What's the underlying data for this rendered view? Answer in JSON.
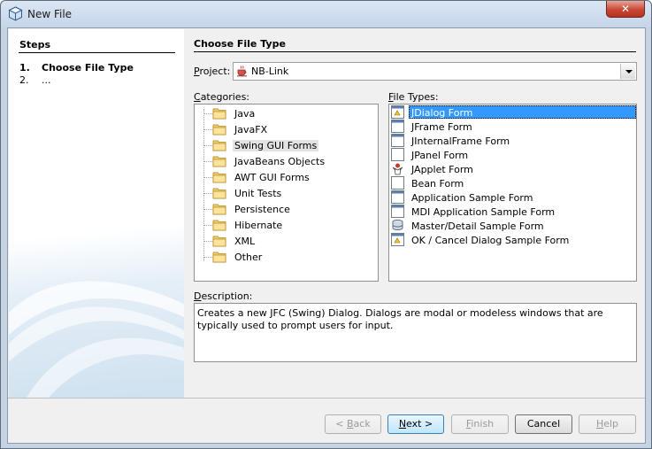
{
  "window": {
    "title": "New File",
    "close_glyph": "✕"
  },
  "steps": {
    "title": "Steps",
    "items": [
      {
        "num": "1.",
        "label": "Choose File Type"
      },
      {
        "num": "2.",
        "label": "..."
      }
    ]
  },
  "main": {
    "title": "Choose File Type",
    "project": {
      "label_u": "P",
      "label_rest": "roject:",
      "value": "NB-Link"
    },
    "categories": {
      "label_u": "C",
      "label_rest": "ategories:",
      "items": [
        "Java",
        "JavaFX",
        "Swing GUI Forms",
        "JavaBeans Objects",
        "AWT GUI Forms",
        "Unit Tests",
        "Persistence",
        "Hibernate",
        "XML",
        "Other"
      ],
      "selected": "Swing GUI Forms"
    },
    "file_types": {
      "label_u": "F",
      "label_rest": "ile Types:",
      "items": [
        "JDialog Form",
        "JFrame Form",
        "JInternalFrame Form",
        "JPanel Form",
        "JApplet Form",
        "Bean Form",
        "Application Sample Form",
        "MDI Application Sample Form",
        "Master/Detail Sample Form",
        "OK / Cancel Dialog Sample Form"
      ],
      "selected": "JDialog Form"
    },
    "description": {
      "label_u": "D",
      "label_rest": "escription:",
      "text": "Creates a new JFC (Swing) Dialog. Dialogs are modal or modeless windows that are typically used to prompt users for input."
    }
  },
  "buttons": {
    "back": {
      "prefix": "< ",
      "u": "B",
      "rest": "ack"
    },
    "next": {
      "prefix": "",
      "u": "N",
      "rest": "ext >"
    },
    "finish": {
      "prefix": "",
      "u": "F",
      "rest": "inish"
    },
    "cancel": {
      "label": "Cancel"
    },
    "help": {
      "prefix": "",
      "u": "H",
      "rest": "elp"
    }
  },
  "colors": {
    "selection": "#3399ff",
    "close": "#c74836"
  }
}
